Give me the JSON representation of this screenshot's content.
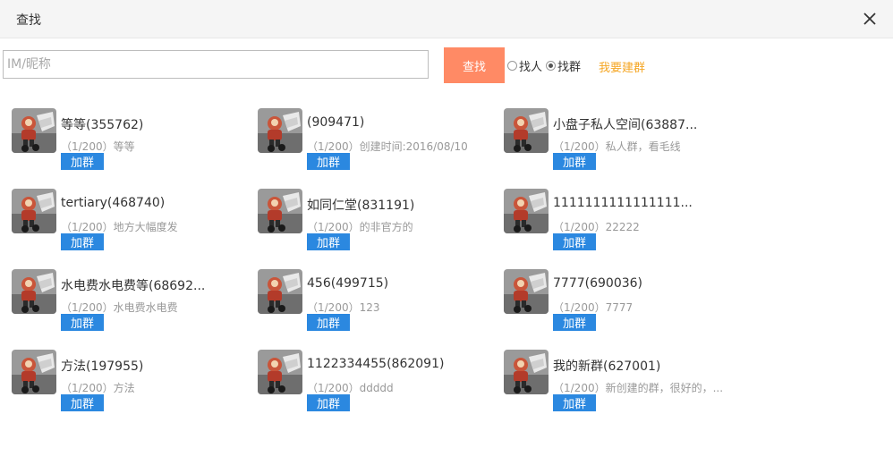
{
  "window": {
    "title": "查找"
  },
  "search": {
    "placeholder": "IM/昵称",
    "value": "",
    "button_label": "查找"
  },
  "options": [
    {
      "label": "找人",
      "checked": false
    },
    {
      "label": "找群",
      "checked": true
    }
  ],
  "create_group_label": "我要建群",
  "join_label": "加群",
  "colors": {
    "accent_orange": "#ff8a65",
    "join_blue": "#2b88e0",
    "link_gold": "#f5a623"
  },
  "groups": [
    {
      "name": "等等(355762)",
      "desc": "（1/200）等等"
    },
    {
      "name": "(909471)",
      "desc": "（1/200）创建时间:2016/08/10"
    },
    {
      "name": "小盘子私人空间(63887...",
      "desc": "（1/200）私人群，看毛线"
    },
    {
      "name": "tertiary(468740)",
      "desc": "（1/200）地方大幅度发"
    },
    {
      "name": "如同仁堂(831191)",
      "desc": "（1/200）的非官方的"
    },
    {
      "name": "1111111111111111...",
      "desc": "（1/200）22222"
    },
    {
      "name": "水电费水电费等(68692...",
      "desc": "（1/200）水电费水电费"
    },
    {
      "name": "456(499715)",
      "desc": "（1/200）123"
    },
    {
      "name": "7777(690036)",
      "desc": "（1/200）7777"
    },
    {
      "name": "方法(197955)",
      "desc": "（1/200）方法"
    },
    {
      "name": "1122334455(862091)",
      "desc": "（1/200）ddddd"
    },
    {
      "name": "我的新群(627001)",
      "desc": "（1/200）新创建的群，很好的，..."
    }
  ]
}
